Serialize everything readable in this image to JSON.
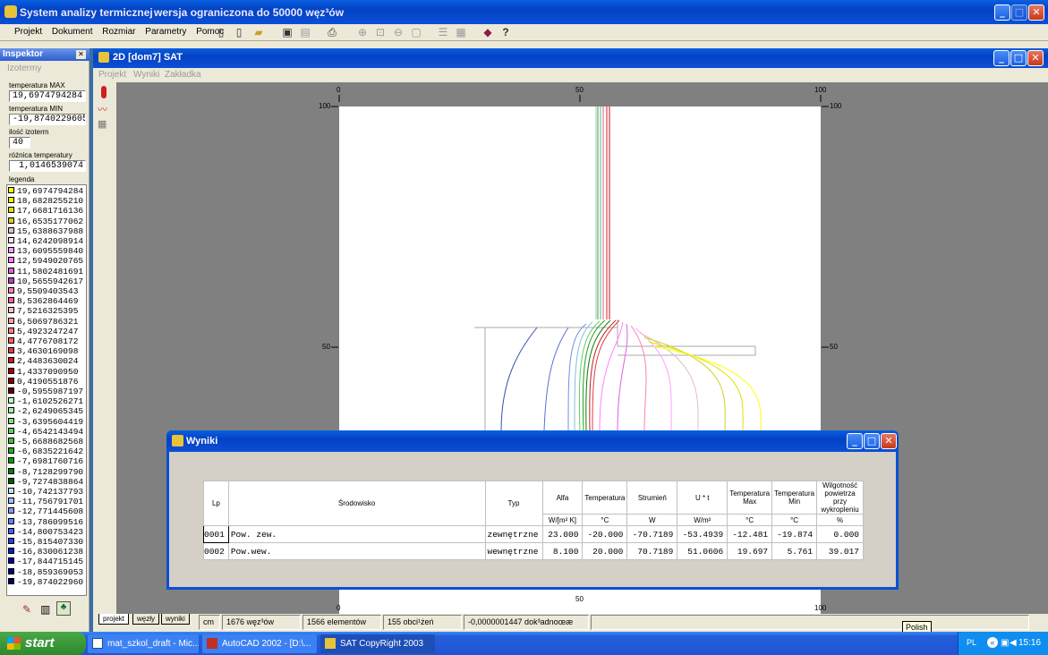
{
  "app": {
    "title": "System analizy termicznej",
    "subtitle": "wersja ograniczona do 50000 węz³ów"
  },
  "menu": [
    "Projekt",
    "Dokument",
    "Rozmiar",
    "Parametry",
    "Pomoc"
  ],
  "inspector": {
    "title": "Inspektor",
    "tab": "Izotermy",
    "tmax_label": "temperatura MAX",
    "tmax": "19,6974794284",
    "tmin_label": "temperatura MIN",
    "tmin": "-19,8740229605",
    "count_label": "ilość izoterm",
    "count": "40",
    "diff_label": "różnica temperatury",
    "diff": "1,0146539074",
    "legend_label": "legenda",
    "legend": [
      {
        "v": "19,6974794284",
        "c": "#ffff00"
      },
      {
        "v": "18,6828255210",
        "c": "#f0f000"
      },
      {
        "v": "17,6681716136",
        "c": "#e0e000"
      },
      {
        "v": "16,6535177062",
        "c": "#d0d020"
      },
      {
        "v": "15,6388637988",
        "c": "#e0c0c0"
      },
      {
        "v": "14,6242098914",
        "c": "#ffe0ff"
      },
      {
        "v": "13,6095559840",
        "c": "#ffa0ff"
      },
      {
        "v": "12,5949020765",
        "c": "#ff80ff"
      },
      {
        "v": "11,5802481691",
        "c": "#e060e0"
      },
      {
        "v": "10,5655942617",
        "c": "#c040c0"
      },
      {
        "v": "9,5509403543",
        "c": "#ff80c0"
      },
      {
        "v": "8,5362864469",
        "c": "#ff60a0"
      },
      {
        "v": "7,5216325395",
        "c": "#ffc0c0"
      },
      {
        "v": "6,5069786321",
        "c": "#ffa0a0"
      },
      {
        "v": "5,4923247247",
        "c": "#ff8080"
      },
      {
        "v": "4,4776708172",
        "c": "#ff6060"
      },
      {
        "v": "3,4630169098",
        "c": "#e04040"
      },
      {
        "v": "2,4483630024",
        "c": "#c02020"
      },
      {
        "v": "1,4337090950",
        "c": "#a00000"
      },
      {
        "v": "0,4190551876",
        "c": "#800000"
      },
      {
        "v": "-0,5955987197",
        "c": "#600000"
      },
      {
        "v": "-1,6102526271",
        "c": "#c0ffc0"
      },
      {
        "v": "-2,6249065345",
        "c": "#a0f0a0"
      },
      {
        "v": "-3,6395604419",
        "c": "#80e080"
      },
      {
        "v": "-4,6542143494",
        "c": "#60d060"
      },
      {
        "v": "-5,6688682568",
        "c": "#40c040"
      },
      {
        "v": "-6,6835221642",
        "c": "#20b020"
      },
      {
        "v": "-7,6981760716",
        "c": "#00a000"
      },
      {
        "v": "-8,7128299790",
        "c": "#008000"
      },
      {
        "v": "-9,7274838864",
        "c": "#006000"
      },
      {
        "v": "-10,742137793",
        "c": "#c0e0ff"
      },
      {
        "v": "-11,756791701",
        "c": "#a0c0ff"
      },
      {
        "v": "-12,771445608",
        "c": "#80a0ff"
      },
      {
        "v": "-13,786099516",
        "c": "#6080ff"
      },
      {
        "v": "-14,800753423",
        "c": "#4060ff"
      },
      {
        "v": "-15,815407330",
        "c": "#2040e0"
      },
      {
        "v": "-16,830061238",
        "c": "#0020c0"
      },
      {
        "v": "-17,844715145",
        "c": "#0000a0"
      },
      {
        "v": "-18,859369053",
        "c": "#000080"
      },
      {
        "v": "-19,874022960",
        "c": "#000060"
      }
    ]
  },
  "child": {
    "title": "2D   [dom7] SAT",
    "menu": [
      "Projekt",
      "Wyniki",
      "Zakładka"
    ]
  },
  "ruler": {
    "top": [
      "0",
      "50",
      "100"
    ],
    "left": [
      "100",
      "50"
    ],
    "right": [
      "100",
      "50"
    ],
    "bottom": [
      "0",
      "50",
      "100"
    ]
  },
  "tabs": [
    "projekt",
    "węzły",
    "wyniki"
  ],
  "status": {
    "unit": "cm",
    "nodes": "1676 węz³ów",
    "elements": "1566 elementów",
    "loads": "155 obci¹żeń",
    "accuracy": "-0,0000001447 dok³adnoœæ"
  },
  "dialog": {
    "title": "Wyniki",
    "headers": [
      "Lp",
      "Środowisko",
      "Typ",
      "Alfa",
      "Temperatura",
      "Strumień",
      "U * t",
      "Temperatura Max",
      "Temperatura Min",
      "Wilgotność powietrza przy wykropleniu"
    ],
    "units": [
      "W/[m² K]",
      "°C",
      "W",
      "W/m²",
      "°C",
      "°C",
      "%"
    ],
    "rows": [
      {
        "lp": "0001",
        "env": "Pow. zew.",
        "type": "zewnętrzne",
        "alfa": "23.000",
        "temp": "-20.000",
        "flux": "-70.7189",
        "ut": "-53.4939",
        "tmax": "-12.481",
        "tmin": "-19.874",
        "hum": "0.000"
      },
      {
        "lp": "0002",
        "env": "Pow.wew.",
        "type": "wewnętrzne",
        "alfa": "8.100",
        "temp": "20.000",
        "flux": "70.7189",
        "ut": "51.0606",
        "tmax": "19.697",
        "tmin": "5.761",
        "hum": "39.017"
      }
    ]
  },
  "tooltip": "Polish",
  "taskbar": {
    "start": "start",
    "items": [
      "mat_szkol_draft - Mic...",
      "AutoCAD 2002 - [D:\\...",
      "SAT CopyRight 2003"
    ],
    "lang": "PL",
    "clock": "15:16"
  }
}
